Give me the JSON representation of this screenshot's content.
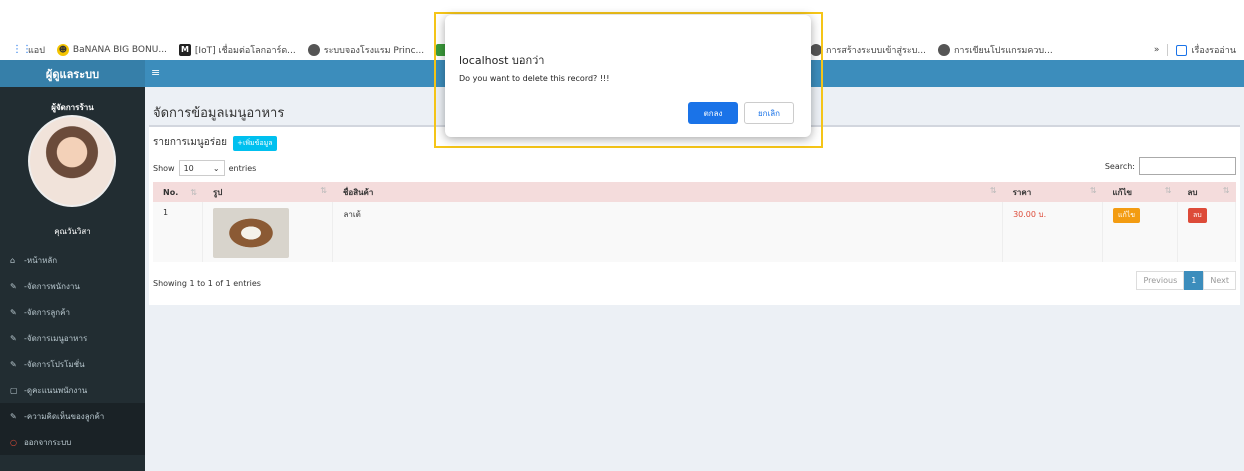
{
  "bookmarks": {
    "items": [
      {
        "icon": "apps-grid-icon",
        "label": "แอป"
      },
      {
        "icon": "banana-icon",
        "label": "BaNANA BIG BONU..."
      },
      {
        "icon": "m-icon",
        "label": "[IoT] เชื่อมต่อโลกอาร์ด..."
      },
      {
        "icon": "globe-icon",
        "label": "ระบบจองโรงแรม Princ..."
      },
      {
        "icon": "green-icon",
        "label": ""
      }
    ],
    "hidden_items": [
      {
        "icon": "globe-icon",
        "label": "การสร้างระบบเข้าสู่ระบ..."
      },
      {
        "icon": "globe-icon",
        "label": "การเขียนโปรแกรมควบ..."
      }
    ],
    "more": "»",
    "reading_list": "เรื่องรออ่าน"
  },
  "header": {
    "brand": "ผู้ดูแลระบบ",
    "toggle": "≡"
  },
  "sidebar": {
    "role": "ผู้จัดการร้าน",
    "username": "คุณวันวิสา",
    "items": [
      {
        "icon": "home-icon",
        "label": "-หน้าหลัก"
      },
      {
        "icon": "edit-icon",
        "label": "-จัดการพนักงาน"
      },
      {
        "icon": "edit-icon",
        "label": "-จัดการลูกค้า"
      },
      {
        "icon": "edit-icon",
        "label": "-จัดการเมนูอาหาร"
      },
      {
        "icon": "edit-icon",
        "label": "-จัดการโปรโมชั่น"
      },
      {
        "icon": "document-icon",
        "label": "-ดูคะแนนพนักงาน"
      },
      {
        "icon": "edit-icon",
        "label": "-ความคิดเห็นของลูกค้า"
      },
      {
        "icon": "power-icon",
        "label": "ออกจากระบบ"
      }
    ]
  },
  "main": {
    "title": "จัดการข้อมูลเมนูอาหาร",
    "box_title": "รายการเมนูอร่อย",
    "add_button": "+เพิ่มข้อมูล",
    "show_label": "Show",
    "entries_value": "10",
    "entries_label": "entries",
    "search_label": "Search:",
    "columns": [
      "No.",
      "รูป",
      "ชื่อสินค้า",
      "ราคา",
      "แก้ไข",
      "ลบ"
    ],
    "rows": [
      {
        "no": "1",
        "name": "ลาเต้",
        "price": "30.00 บ.",
        "edit": "แก้ไข",
        "delete": "ลบ"
      }
    ],
    "info": "Showing 1 to 1 of 1 entries",
    "pager": {
      "previous": "Previous",
      "current": "1",
      "next": "Next"
    }
  },
  "dialog": {
    "title": "localhost บอกว่า",
    "message": "Do you want to delete this record? !!!",
    "ok": "ตกลง",
    "cancel": "ยกเลิก"
  }
}
